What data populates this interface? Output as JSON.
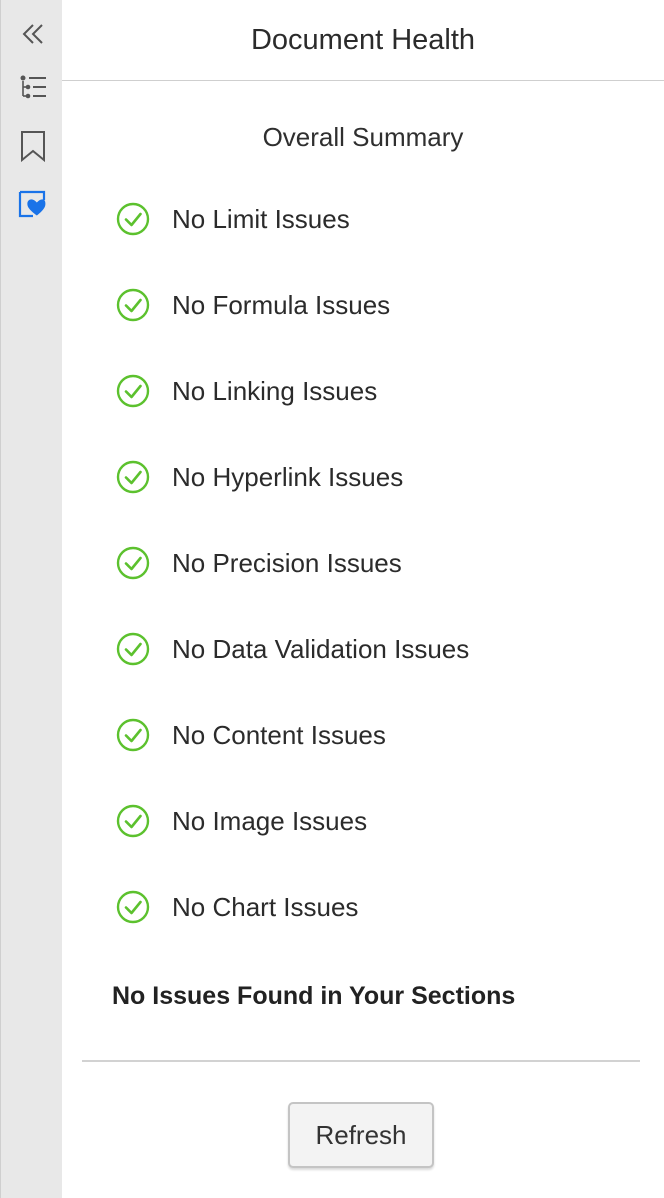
{
  "colors": {
    "accent": "#1a73e8",
    "success": "#5cc12e",
    "rail_background": "#e8e8e8",
    "icon_gray": "#555555"
  },
  "rail": {
    "items": [
      {
        "icon": "collapse-chevrons-icon",
        "active": false
      },
      {
        "icon": "outline-list-icon",
        "active": false
      },
      {
        "icon": "bookmark-icon",
        "active": false
      },
      {
        "icon": "document-health-heart-icon",
        "active": true
      }
    ]
  },
  "header": {
    "title": "Document Health"
  },
  "summary": {
    "title": "Overall Summary",
    "items": [
      {
        "label": "No Limit Issues",
        "status_icon": "check-circle-icon"
      },
      {
        "label": "No Formula Issues",
        "status_icon": "check-circle-icon"
      },
      {
        "label": "No Linking Issues",
        "status_icon": "check-circle-icon"
      },
      {
        "label": "No Hyperlink Issues",
        "status_icon": "check-circle-icon"
      },
      {
        "label": "No Precision Issues",
        "status_icon": "check-circle-icon"
      },
      {
        "label": "No Data Validation Issues",
        "status_icon": "check-circle-icon"
      },
      {
        "label": "No Content Issues",
        "status_icon": "check-circle-icon"
      },
      {
        "label": "No Image Issues",
        "status_icon": "check-circle-icon"
      },
      {
        "label": "No Chart Issues",
        "status_icon": "check-circle-icon"
      }
    ],
    "result_text": "No Issues Found in Your Sections"
  },
  "footer": {
    "refresh_label": "Refresh"
  }
}
